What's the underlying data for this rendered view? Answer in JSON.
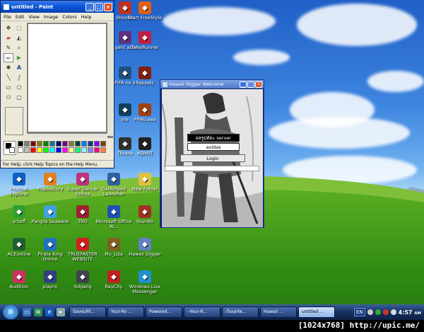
{
  "paint": {
    "title": "untitled - Paint",
    "menu": [
      "File",
      "Edit",
      "View",
      "Image",
      "Colors",
      "Help"
    ],
    "tool_icons": [
      "free-select",
      "select",
      "eraser",
      "fill",
      "color-picker",
      "magnifier",
      "pencil",
      "brush",
      "airbrush",
      "text",
      "line",
      "curve",
      "rectangle",
      "polygon",
      "ellipse",
      "rounded-rectangle"
    ],
    "palette": [
      "#000000",
      "#808080",
      "#800000",
      "#808000",
      "#008000",
      "#008080",
      "#000080",
      "#800080",
      "#808040",
      "#004040",
      "#0080ff",
      "#004080",
      "#8000ff",
      "#804000",
      "#ffffff",
      "#c0c0c0",
      "#ff0000",
      "#ffff00",
      "#00ff00",
      "#00ffff",
      "#0000ff",
      "#ff00ff",
      "#ffff80",
      "#00ff80",
      "#80ffff",
      "#8080ff",
      "#ff0080",
      "#ff8040"
    ],
    "status": "For Help, click Help Topics on the Help Menu."
  },
  "hawaii": {
    "title": "Hawaii Digger Welcome",
    "server": "ผลรูปตัดะ server",
    "user": "aoidas",
    "login": "Login"
  },
  "desktop_icons": [
    {
      "label": "Shooter",
      "color": "#c03020"
    },
    {
      "label": "Start FreeStyle",
      "color": "#e06010"
    },
    {
      "label": "Agent ation",
      "color": "#603080"
    },
    {
      "label": "TalesRunner",
      "color": "#c02040"
    },
    {
      "label": "FIFA ne 2",
      "color": "#205080"
    },
    {
      "label": "Rappelz",
      "color": "#802010"
    },
    {
      "label": "ine",
      "color": "#104060"
    },
    {
      "label": "PPMu.exe",
      "color": "#a04010"
    },
    {
      "label": "Throne",
      "color": "#303030"
    },
    {
      "label": "XSHOT",
      "color": "#202020"
    },
    {
      "label": "Internet Explorer",
      "color": "#1060c0"
    },
    {
      "label": "MapleStory",
      "color": "#e08020"
    },
    {
      "label": "Super Dancer Online",
      "color": "#c03080"
    },
    {
      "label": "GetAmped Launcher",
      "color": "#3060a0"
    },
    {
      "label": "New Folder",
      "color": "#e0c040"
    },
    {
      "label": "นาเมกี",
      "color": "#30a030"
    },
    {
      "label": "PangYa Season4",
      "color": "#40a0e0"
    },
    {
      "label": "TRO",
      "color": "#a02030"
    },
    {
      "label": "Microsoft Office W...",
      "color": "#2050b0"
    },
    {
      "label": "Your-Ro",
      "color": "#a03020"
    },
    {
      "label": "ACEonline",
      "color": "#206030"
    },
    {
      "label": "Pirate King Online",
      "color": "#2070c0"
    },
    {
      "label": "TRUEFASTER WEBSITE",
      "color": "#d02020"
    },
    {
      "label": "Mu_Liza",
      "color": "#806020"
    },
    {
      "label": "Hawaii Digger",
      "color": "#6080c0"
    },
    {
      "label": "Audition",
      "color": "#d03060"
    },
    {
      "label": "plaync",
      "color": "#304080"
    },
    {
      "label": "Yulgang",
      "color": "#404050"
    },
    {
      "label": "RayCity",
      "color": "#c02020"
    },
    {
      "label": "Windows Live Messenger",
      "color": "#2090d0"
    }
  ],
  "taskbar": {
    "tasks": [
      "SaveUFil...",
      "Your-Ro ...",
      "Powered...",
      "--Your-R...",
      "เว็บบอร์ด...",
      "Hawaii ...",
      "untitled ..."
    ],
    "active_task_index": 6,
    "language": "EN",
    "clock_time": "4:57",
    "clock_ampm": "AM"
  },
  "watermark": "[1024x768] http://upic.me/"
}
